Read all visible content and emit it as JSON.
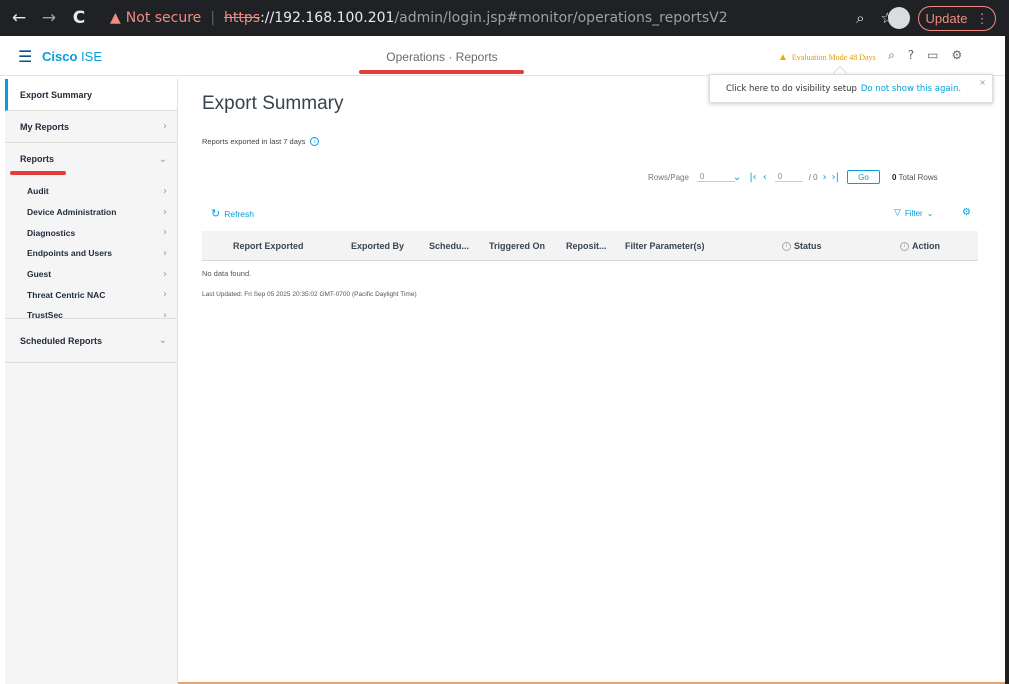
{
  "browser": {
    "back": "←",
    "forward": "→",
    "reload": "C",
    "security_label": "Not secure",
    "url_scheme": "https",
    "url_host": "://192.168.100.201",
    "url_path": "/admin/login.jsp#monitor/operations_reportsV2",
    "update_label": "Update"
  },
  "app": {
    "brand_main": "Cisco",
    "brand_sub": "ISE",
    "breadcrumb": "Operations · Reports",
    "evaluation": "Evaluation Mode 48 Days"
  },
  "popover": {
    "text": "Click here to do visibility setup",
    "link": "Do not show this again.",
    "close": "×"
  },
  "sidebar": {
    "export_summary": "Export Summary",
    "my_reports": "My Reports",
    "reports": "Reports",
    "sub_items": [
      "Audit",
      "Device Administration",
      "Diagnostics",
      "Endpoints and Users",
      "Guest",
      "Threat Centric NAC",
      "TrustSec"
    ],
    "scheduled_reports": "Scheduled Reports"
  },
  "main": {
    "title": "Export Summary",
    "subtitle": "Reports exported in last 7 days",
    "rows_per_page_label": "Rows/Page",
    "rows_per_page_value": "0",
    "page_value": "0",
    "page_total": "/ 0",
    "go_label": "Go",
    "total_count": "0",
    "total_label": "Total Rows",
    "refresh_label": "Refresh",
    "filter_label": "Filter",
    "columns": [
      "Report Exported",
      "Exported By",
      "Schedu...",
      "Triggered On",
      "Reposit...",
      "Filter Parameter(s)",
      "Status",
      "Action"
    ],
    "no_data": "No data found.",
    "last_updated": "Last Updated: Fri Sep 05 2025 20:35:02 GMT-0700 (Pacific Daylight Time)"
  }
}
